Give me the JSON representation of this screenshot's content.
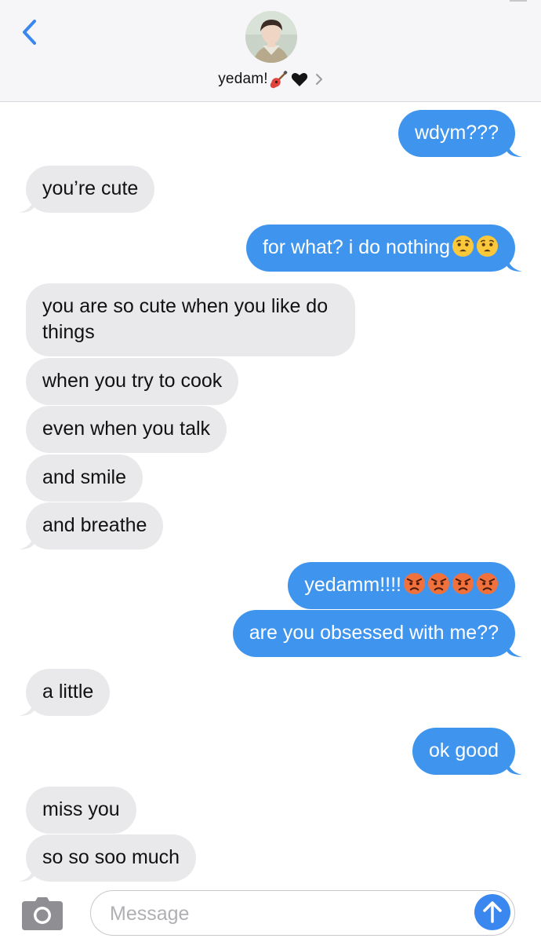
{
  "header": {
    "contact_name": "yedam!",
    "name_icons": [
      "guitar-icon",
      "black-heart-icon"
    ]
  },
  "colors": {
    "outgoing_bubble": "#3f95ee",
    "incoming_bubble": "#e9e9eb",
    "accent": "#3a87ef"
  },
  "messages": [
    {
      "side": "out",
      "text": "wdym???"
    },
    {
      "side": "in",
      "text": "you’re cute"
    },
    {
      "side": "out",
      "text": "for what? i do nothing",
      "emoji": [
        "anguished-face-icon",
        "anguished-face-icon"
      ]
    },
    {
      "side": "in",
      "text": "you are so cute when you like do things"
    },
    {
      "side": "in",
      "text": "when you try to cook"
    },
    {
      "side": "in",
      "text": "even when you talk"
    },
    {
      "side": "in",
      "text": "and smile"
    },
    {
      "side": "in",
      "text": "and breathe"
    },
    {
      "side": "out",
      "text": "yedamm!!!!",
      "emoji": [
        "angry-face-icon",
        "angry-face-icon",
        "angry-face-icon",
        "angry-face-icon"
      ]
    },
    {
      "side": "out",
      "text": "are you obsessed with me??"
    },
    {
      "side": "in",
      "text": "a little"
    },
    {
      "side": "out",
      "text": "ok good"
    },
    {
      "side": "in",
      "text": "miss you"
    },
    {
      "side": "in",
      "text": "so so soo much"
    }
  ],
  "composer": {
    "placeholder": "Message"
  }
}
